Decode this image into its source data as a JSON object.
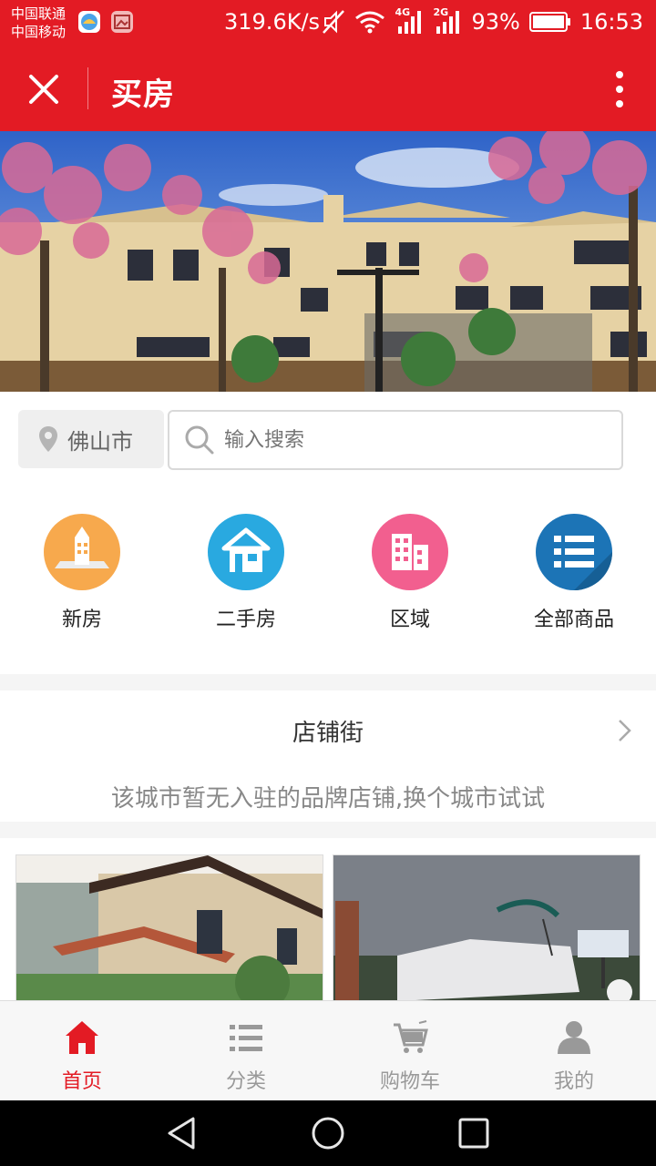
{
  "status_bar": {
    "carrier_1": "中国联通",
    "carrier_2": "中国移动",
    "net_speed": "319.6K/s",
    "net_4g": "4G",
    "net_2g": "2G",
    "battery": "93%",
    "time": "16:53"
  },
  "app_bar": {
    "title": "买房",
    "close_icon": "close-icon",
    "menu_icon": "more-vertical-icon"
  },
  "search": {
    "city": "佛山市",
    "placeholder": "输入搜索"
  },
  "quick_entries": [
    {
      "label": "新房",
      "icon": "building-icon",
      "color": "#f7a94d"
    },
    {
      "label": "二手房",
      "icon": "house-icon",
      "color": "#29a9e0"
    },
    {
      "label": "区域",
      "icon": "city-blocks-icon",
      "color": "#f25f8f"
    },
    {
      "label": "全部商品",
      "icon": "list-icon",
      "color": "#1c74b6"
    }
  ],
  "shop_street": {
    "title": "店铺街",
    "empty_message": "该城市暂无入驻的品牌店铺,换个城市试试"
  },
  "tab_bar": [
    {
      "label": "首页",
      "icon": "home-icon",
      "active": true
    },
    {
      "label": "分类",
      "icon": "category-list-icon",
      "active": false
    },
    {
      "label": "购物车",
      "icon": "cart-icon",
      "active": false
    },
    {
      "label": "我的",
      "icon": "user-icon",
      "active": false
    }
  ],
  "colors": {
    "brand_red": "#e31b24",
    "page_bg": "#f5f5f5"
  }
}
